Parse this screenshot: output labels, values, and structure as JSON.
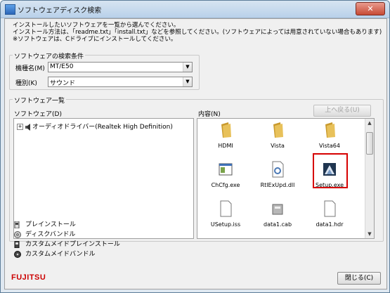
{
  "window": {
    "title": "ソフトウェアディスク検索",
    "close_glyph": "✕"
  },
  "intro": {
    "line1": "インストールしたいソフトウェアを一覧から選んでください。",
    "line2": "インストール方法は、「readme.txt」「install.txt」などを参照してください。(ソフトウェアによっては用意されていない場合もあります)",
    "line3": "※ソフトウェアは、Cドライブにインストールしてください。"
  },
  "search": {
    "legend": "ソフトウェアの検索条件",
    "model_label": "機種名(M)",
    "model_value": "MT/E50",
    "kind_label": "種別(K)",
    "kind_value": "サウンド",
    "dropdown_glyph": "▼"
  },
  "list": {
    "legend": "ソフトウェア一覧",
    "software_label": "ソフトウェア(D)",
    "contents_label": "内容(N)",
    "up_button": "上へ戻る(U)",
    "tree_expander": "+",
    "tree_item": "オーディオドライバー(Realtek High Definition)",
    "files": [
      {
        "name": "HDMI",
        "icon": "folder-icon"
      },
      {
        "name": "Vista",
        "icon": "folder-icon"
      },
      {
        "name": "Vista64",
        "icon": "folder-icon"
      },
      {
        "name": "ChCfg.exe",
        "icon": "exe-icon"
      },
      {
        "name": "RtlExUpd.dll",
        "icon": "dll-icon"
      },
      {
        "name": "Setup.exe",
        "icon": "setup-icon"
      },
      {
        "name": "USetup.iss",
        "icon": "file-icon"
      },
      {
        "name": "data1.cab",
        "icon": "cab-icon"
      },
      {
        "name": "data1.hdr",
        "icon": "file-icon"
      }
    ],
    "scroll_up_glyph": "▲",
    "scroll_down_glyph": "▼"
  },
  "legend_items": [
    {
      "label": "プレインストール",
      "icon": "preinstall-icon"
    },
    {
      "label": "ディスクバンドル",
      "icon": "disc-bundle-icon"
    },
    {
      "label": "カスタムメイドプレインストール",
      "icon": "custom-preinstall-icon"
    },
    {
      "label": "カスタムメイドバンドル",
      "icon": "custom-bundle-icon"
    }
  ],
  "footer": {
    "brand": "FUJITSU",
    "close_button": "閉じる(C)"
  },
  "colors": {
    "highlight": "#d60000",
    "brand": "#cc0000",
    "folder": "#e8c15a"
  }
}
